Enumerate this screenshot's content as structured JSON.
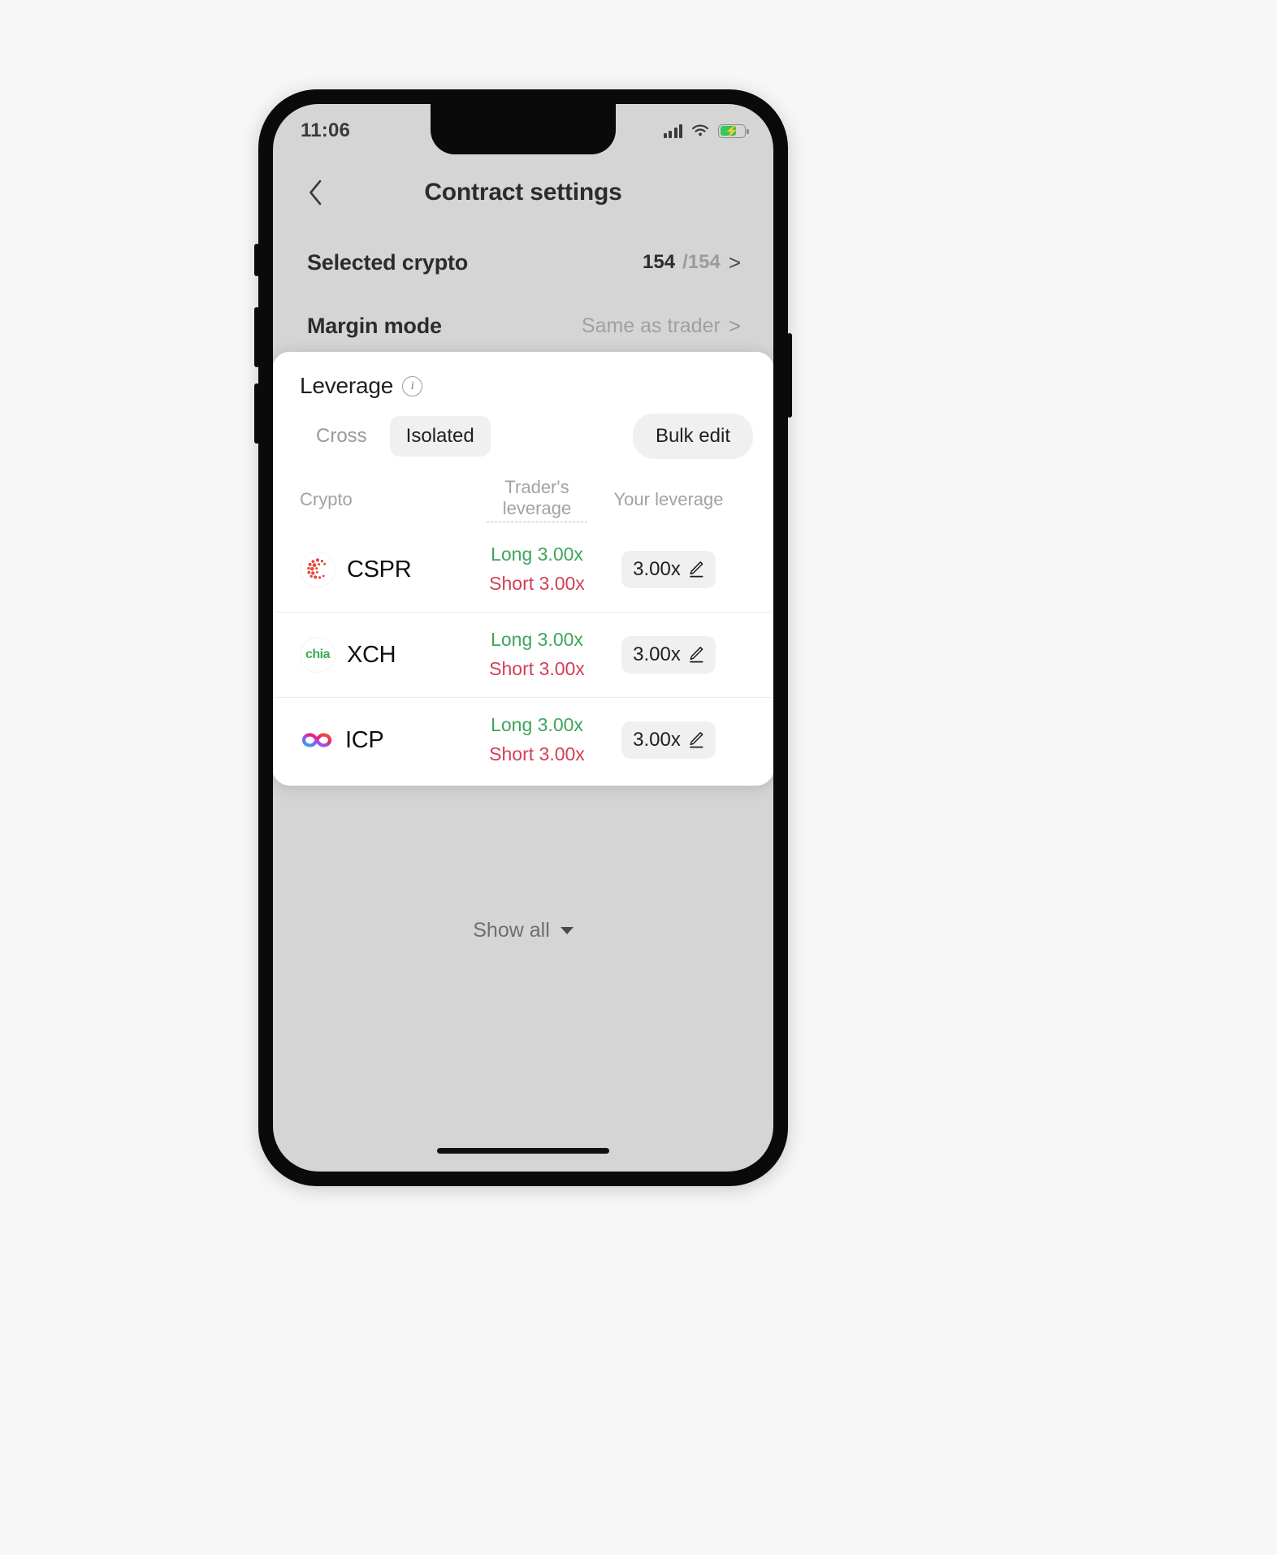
{
  "status_bar": {
    "time": "11:06",
    "signal_icon": "signal-bars-icon",
    "wifi_icon": "wifi-icon",
    "battery_icon": "battery-charging-icon",
    "battery_color": "#34c759"
  },
  "nav": {
    "back_icon": "chevron-left-icon",
    "title": "Contract settings"
  },
  "settings": {
    "rows": [
      {
        "label": "Selected crypto",
        "value_strong": "154",
        "value_muted": "/154",
        "chevron": ">"
      },
      {
        "label": "Margin mode",
        "value_gray": "Same as trader",
        "chevron": ">"
      }
    ]
  },
  "leverage_sheet": {
    "title": "Leverage",
    "info_icon": "info-icon",
    "info_glyph": "i",
    "modes": [
      {
        "label": "Cross",
        "active": false
      },
      {
        "label": "Isolated",
        "active": true
      }
    ],
    "bulk_edit_label": "Bulk edit",
    "columns": {
      "crypto": "Crypto",
      "trader": "Trader's leverage",
      "your": "Your leverage"
    },
    "rows": [
      {
        "ticker": "CSPR",
        "logo": "casper-logo-icon",
        "long": "Long 3.00x",
        "short": "Short 3.00x",
        "your_leverage": "3.00x",
        "edit_icon": "pencil-icon"
      },
      {
        "ticker": "XCH",
        "logo": "chia-logo-icon",
        "logo_text": "chia",
        "long": "Long 3.00x",
        "short": "Short 3.00x",
        "your_leverage": "3.00x",
        "edit_icon": "pencil-icon"
      },
      {
        "ticker": "ICP",
        "logo": "internet-computer-logo-icon",
        "long": "Long 3.00x",
        "short": "Short 3.00x",
        "your_leverage": "3.00x",
        "edit_icon": "pencil-icon"
      }
    ],
    "colors": {
      "long": "#3fa45b",
      "short": "#d23f56",
      "pill_bg": "#f0f0f0"
    }
  },
  "show_all": {
    "label": "Show all",
    "caret_icon": "caret-down-icon"
  }
}
